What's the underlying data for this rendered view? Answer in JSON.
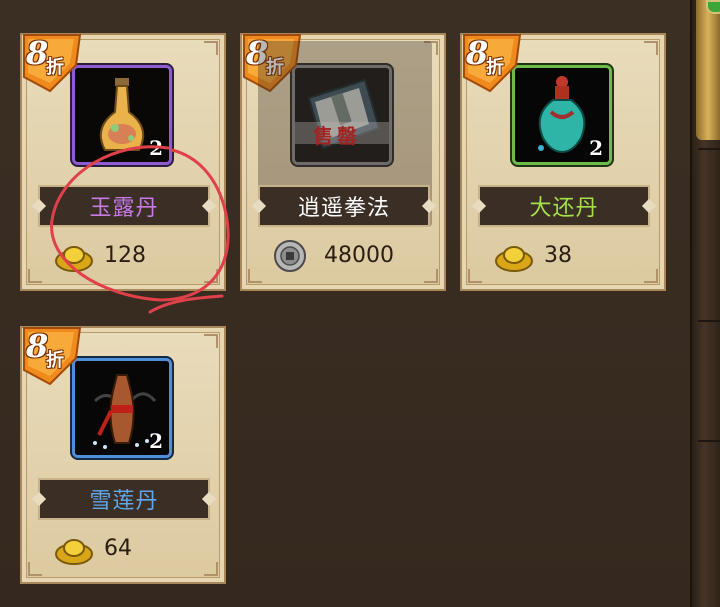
{
  "shop": {
    "items": [
      {
        "name": "玉露丹",
        "quantity": "2",
        "price": "128",
        "currency": "gold-ingot",
        "discount_num": "8",
        "discount_label": "折",
        "name_color": "#c77ae6",
        "rarity": "purple"
      },
      {
        "name": "逍遥拳法",
        "quantity": "",
        "price": "48000",
        "currency": "silver-coin",
        "discount_num": "8",
        "discount_label": "折",
        "name_color": "#ffffff",
        "rarity": "grey",
        "stamp": "售罄"
      },
      {
        "name": "大还丹",
        "quantity": "2",
        "price": "38",
        "currency": "gold-ingot",
        "discount_num": "8",
        "discount_label": "折",
        "name_color": "#a6e04a",
        "rarity": "green"
      },
      {
        "name": "雪莲丹",
        "quantity": "2",
        "price": "64",
        "currency": "gold-ingot",
        "discount_num": "8",
        "discount_label": "折",
        "name_color": "#5fa8ee",
        "rarity": "blue"
      }
    ]
  },
  "colors": {
    "annotation_circle": "#e0404a",
    "card_bg": "#e3d3ad",
    "badge_orange": "#f08a1c"
  }
}
